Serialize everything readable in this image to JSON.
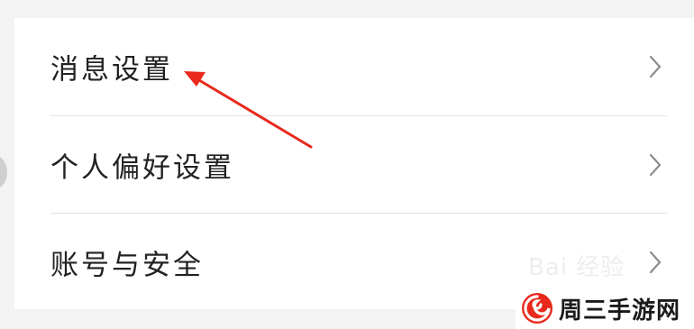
{
  "settings": {
    "items": [
      {
        "label": "消息设置"
      },
      {
        "label": "个人偏好设置"
      },
      {
        "label": "账号与安全"
      }
    ]
  },
  "icons": {
    "row_chevron": "chevron-right-icon",
    "annotation": "red-arrow-annotation",
    "logo": "swirl-logo-icon"
  },
  "watermark": {
    "text": "Bai 经验"
  },
  "site_logo": {
    "name": "周三手游网"
  },
  "colors": {
    "annotation_red": "#e8291c",
    "chevron": "#8c8c8c",
    "logo_red": "#e8291c",
    "page_bg": "#f3f3f3",
    "card_bg": "#ffffff"
  }
}
